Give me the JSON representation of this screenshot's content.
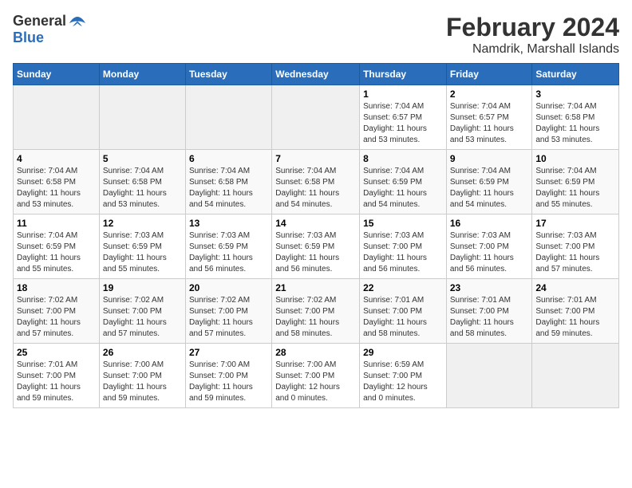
{
  "logo": {
    "general": "General",
    "blue": "Blue"
  },
  "title": "February 2024",
  "subtitle": "Namdrik, Marshall Islands",
  "days_of_week": [
    "Sunday",
    "Monday",
    "Tuesday",
    "Wednesday",
    "Thursday",
    "Friday",
    "Saturday"
  ],
  "weeks": [
    [
      {
        "day": "",
        "detail": ""
      },
      {
        "day": "",
        "detail": ""
      },
      {
        "day": "",
        "detail": ""
      },
      {
        "day": "",
        "detail": ""
      },
      {
        "day": "1",
        "detail": "Sunrise: 7:04 AM\nSunset: 6:57 PM\nDaylight: 11 hours\nand 53 minutes."
      },
      {
        "day": "2",
        "detail": "Sunrise: 7:04 AM\nSunset: 6:57 PM\nDaylight: 11 hours\nand 53 minutes."
      },
      {
        "day": "3",
        "detail": "Sunrise: 7:04 AM\nSunset: 6:58 PM\nDaylight: 11 hours\nand 53 minutes."
      }
    ],
    [
      {
        "day": "4",
        "detail": "Sunrise: 7:04 AM\nSunset: 6:58 PM\nDaylight: 11 hours\nand 53 minutes."
      },
      {
        "day": "5",
        "detail": "Sunrise: 7:04 AM\nSunset: 6:58 PM\nDaylight: 11 hours\nand 53 minutes."
      },
      {
        "day": "6",
        "detail": "Sunrise: 7:04 AM\nSunset: 6:58 PM\nDaylight: 11 hours\nand 54 minutes."
      },
      {
        "day": "7",
        "detail": "Sunrise: 7:04 AM\nSunset: 6:58 PM\nDaylight: 11 hours\nand 54 minutes."
      },
      {
        "day": "8",
        "detail": "Sunrise: 7:04 AM\nSunset: 6:59 PM\nDaylight: 11 hours\nand 54 minutes."
      },
      {
        "day": "9",
        "detail": "Sunrise: 7:04 AM\nSunset: 6:59 PM\nDaylight: 11 hours\nand 54 minutes."
      },
      {
        "day": "10",
        "detail": "Sunrise: 7:04 AM\nSunset: 6:59 PM\nDaylight: 11 hours\nand 55 minutes."
      }
    ],
    [
      {
        "day": "11",
        "detail": "Sunrise: 7:04 AM\nSunset: 6:59 PM\nDaylight: 11 hours\nand 55 minutes."
      },
      {
        "day": "12",
        "detail": "Sunrise: 7:03 AM\nSunset: 6:59 PM\nDaylight: 11 hours\nand 55 minutes."
      },
      {
        "day": "13",
        "detail": "Sunrise: 7:03 AM\nSunset: 6:59 PM\nDaylight: 11 hours\nand 56 minutes."
      },
      {
        "day": "14",
        "detail": "Sunrise: 7:03 AM\nSunset: 6:59 PM\nDaylight: 11 hours\nand 56 minutes."
      },
      {
        "day": "15",
        "detail": "Sunrise: 7:03 AM\nSunset: 7:00 PM\nDaylight: 11 hours\nand 56 minutes."
      },
      {
        "day": "16",
        "detail": "Sunrise: 7:03 AM\nSunset: 7:00 PM\nDaylight: 11 hours\nand 56 minutes."
      },
      {
        "day": "17",
        "detail": "Sunrise: 7:03 AM\nSunset: 7:00 PM\nDaylight: 11 hours\nand 57 minutes."
      }
    ],
    [
      {
        "day": "18",
        "detail": "Sunrise: 7:02 AM\nSunset: 7:00 PM\nDaylight: 11 hours\nand 57 minutes."
      },
      {
        "day": "19",
        "detail": "Sunrise: 7:02 AM\nSunset: 7:00 PM\nDaylight: 11 hours\nand 57 minutes."
      },
      {
        "day": "20",
        "detail": "Sunrise: 7:02 AM\nSunset: 7:00 PM\nDaylight: 11 hours\nand 57 minutes."
      },
      {
        "day": "21",
        "detail": "Sunrise: 7:02 AM\nSunset: 7:00 PM\nDaylight: 11 hours\nand 58 minutes."
      },
      {
        "day": "22",
        "detail": "Sunrise: 7:01 AM\nSunset: 7:00 PM\nDaylight: 11 hours\nand 58 minutes."
      },
      {
        "day": "23",
        "detail": "Sunrise: 7:01 AM\nSunset: 7:00 PM\nDaylight: 11 hours\nand 58 minutes."
      },
      {
        "day": "24",
        "detail": "Sunrise: 7:01 AM\nSunset: 7:00 PM\nDaylight: 11 hours\nand 59 minutes."
      }
    ],
    [
      {
        "day": "25",
        "detail": "Sunrise: 7:01 AM\nSunset: 7:00 PM\nDaylight: 11 hours\nand 59 minutes."
      },
      {
        "day": "26",
        "detail": "Sunrise: 7:00 AM\nSunset: 7:00 PM\nDaylight: 11 hours\nand 59 minutes."
      },
      {
        "day": "27",
        "detail": "Sunrise: 7:00 AM\nSunset: 7:00 PM\nDaylight: 11 hours\nand 59 minutes."
      },
      {
        "day": "28",
        "detail": "Sunrise: 7:00 AM\nSunset: 7:00 PM\nDaylight: 12 hours\nand 0 minutes."
      },
      {
        "day": "29",
        "detail": "Sunrise: 6:59 AM\nSunset: 7:00 PM\nDaylight: 12 hours\nand 0 minutes."
      },
      {
        "day": "",
        "detail": ""
      },
      {
        "day": "",
        "detail": ""
      }
    ]
  ]
}
